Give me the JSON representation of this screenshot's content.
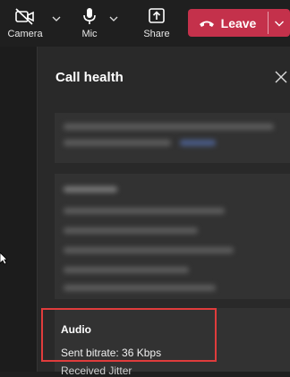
{
  "toolbar": {
    "camera_label": "Camera",
    "mic_label": "Mic",
    "share_label": "Share",
    "leave_label": "Leave"
  },
  "panel": {
    "title": "Call health"
  },
  "audio": {
    "title": "Audio",
    "sent_bitrate": "Sent bitrate: 36 Kbps",
    "received_jitter": "Received Jitter"
  },
  "colors": {
    "leave": "#c4314b",
    "highlight": "#e03c3c",
    "panel_bg": "#292929",
    "toolbar_bg": "#1f1f1f"
  }
}
